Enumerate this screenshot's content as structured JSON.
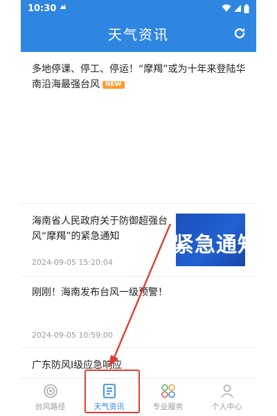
{
  "status_bar": {
    "time": "10:30"
  },
  "header": {
    "title": "天气资讯"
  },
  "headline": {
    "text": "多地停课、停工、停运！“摩羯”或为十年来登陆华南沿海最强台风",
    "badge": "NEW"
  },
  "articles": [
    {
      "title": "海南省人民政府关于防御超强台风“摩羯”的紧急通知",
      "date": "2024-09-05 15:20:04",
      "thumb_text": "紧急通知"
    },
    {
      "title": "刚刚！海南发布台风一级预警！",
      "date": "2024-09-05 10:59:00"
    },
    {
      "title": "广东防风I级应急响应"
    }
  ],
  "bottom_nav": [
    {
      "label": "台风路径",
      "icon": "typhoon-icon"
    },
    {
      "label": "天气资讯",
      "icon": "news-icon",
      "active": true
    },
    {
      "label": "专业服务",
      "icon": "services-icon"
    },
    {
      "label": "个人中心",
      "icon": "profile-icon"
    }
  ],
  "colors": {
    "primary": "#2f86e0",
    "annotation": "#e23b2e",
    "badge": "#ff9a2e"
  }
}
